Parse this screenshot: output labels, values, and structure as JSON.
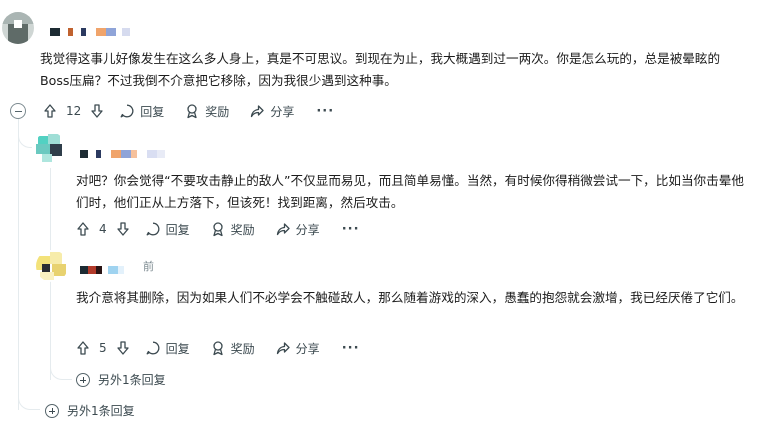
{
  "comments": [
    {
      "text": "我觉得这事儿好像发生在这么多人身上，真是不可思议。到现在为止，我大概遇到过一两次。你是怎么玩的，总是被晕眩的Boss压扁？不过我倒不介意把它移除，因为我很少遇到这种事。",
      "upvotes": "12",
      "reply_label": "回复",
      "award_label": "奖励",
      "share_label": "分享",
      "more_label": "···"
    },
    {
      "text": "对吧？你会觉得“不要攻击静止的敌人”不仅显而易见，而且简单易懂。当然，有时候你得稍微尝试一下，比如当你击晕他们时，他们正从上方落下，但该死！找到距离，然后攻击。",
      "upvotes": "4",
      "reply_label": "回复",
      "award_label": "奖励",
      "share_label": "分享",
      "more_label": "···"
    },
    {
      "username_tail": "前",
      "text": "我介意将其删除，因为如果人们不必学会不触碰敌人，那么随着游戏的深入，愚蠢的抱怨就会激增，我已经厌倦了它们。",
      "upvotes": "5",
      "reply_label": "回复",
      "award_label": "奖励",
      "share_label": "分享",
      "more_label": "···"
    }
  ],
  "more_replies": [
    {
      "label": "另外1条回复"
    },
    {
      "label": "另外1条回复"
    }
  ],
  "colors": {
    "action_text": "#3c4a50",
    "thread_line": "#e5ebee"
  }
}
